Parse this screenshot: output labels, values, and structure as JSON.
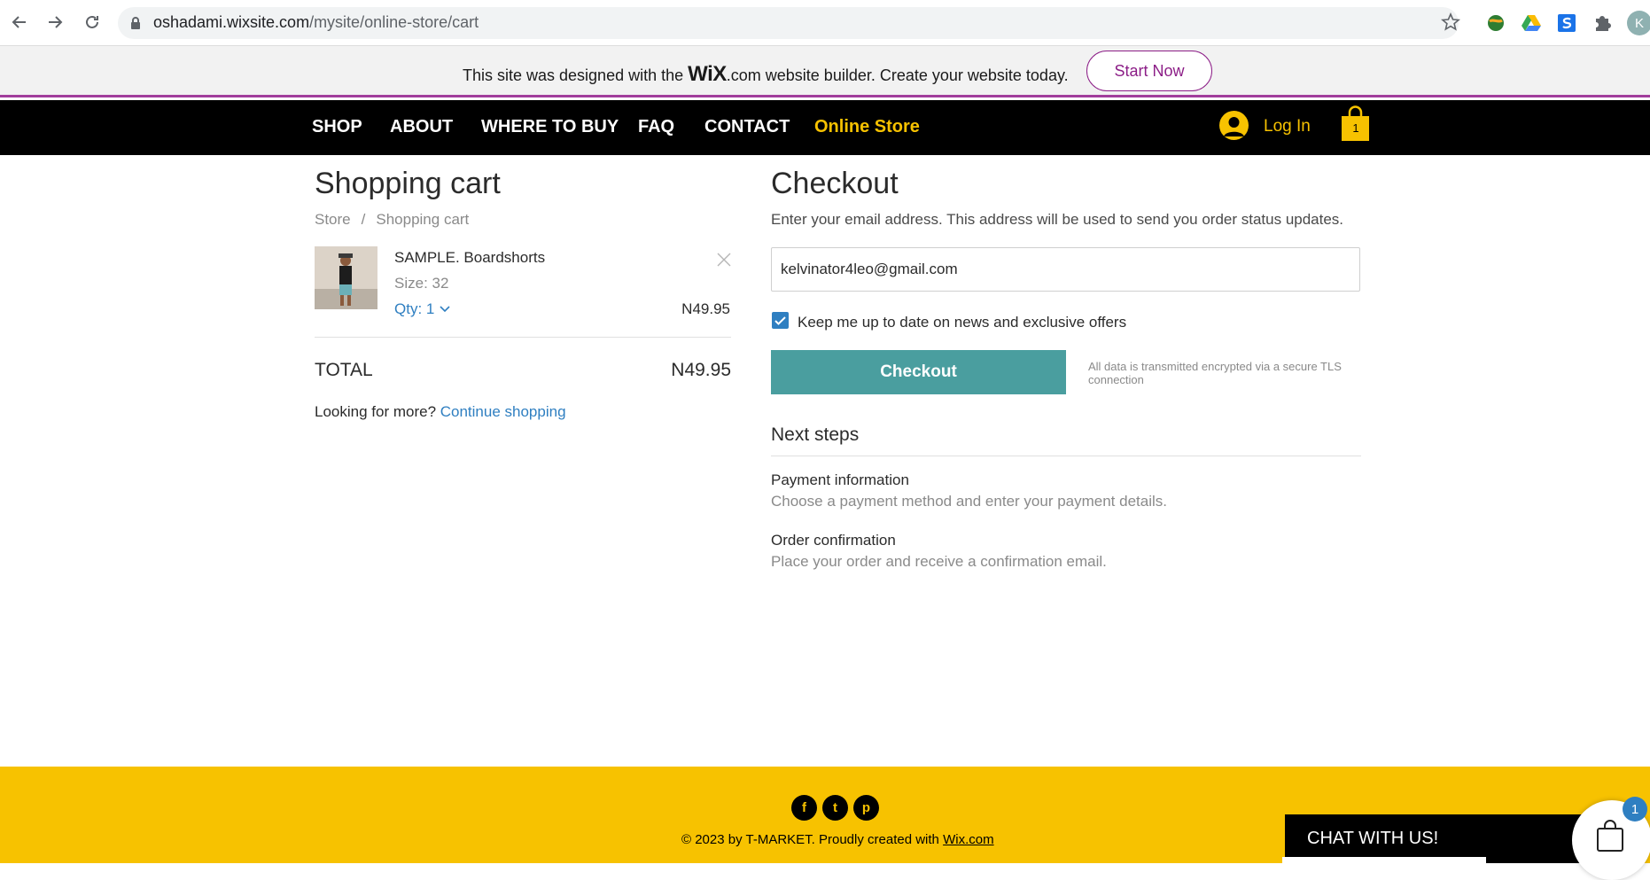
{
  "browser": {
    "url_domain": "oshadami.wixsite.com",
    "url_path": "/mysite/online-store/cart",
    "profile_initial": "K"
  },
  "wix_banner": {
    "text_before": "This site was designed with the ",
    "logo": "WiX",
    "text_after": ".com website builder. Create your website today.",
    "cta": "Start Now"
  },
  "nav": {
    "items": [
      "SHOP",
      "ABOUT",
      "WHERE TO BUY",
      "FAQ",
      "CONTACT",
      "Online Store"
    ],
    "login": "Log In",
    "cart_count": "1"
  },
  "cart": {
    "title": "Shopping cart",
    "breadcrumb": [
      "Store",
      "/",
      "Shopping cart"
    ],
    "item": {
      "name": "SAMPLE. Boardshorts",
      "size": "Size: 32",
      "qty": "Qty: 1",
      "price": "N49.95"
    },
    "total_label": "TOTAL",
    "total_value": "N49.95",
    "looking_more": "Looking for more? ",
    "continue": "Continue shopping"
  },
  "checkout": {
    "title": "Checkout",
    "description": "Enter your email address. This address will be used to send you order status updates.",
    "email": "kelvinator4leo@gmail.com",
    "newsletter_label": "Keep me up to date on news and exclusive offers",
    "button": "Checkout",
    "secure_note": "All data is transmitted encrypted via a secure TLS connection",
    "next_steps_title": "Next steps",
    "steps": [
      {
        "title": "Payment information",
        "desc": "Choose a payment method and enter your payment details."
      },
      {
        "title": "Order confirmation",
        "desc": "Place your order and receive a confirmation email."
      }
    ]
  },
  "footer": {
    "copyright": "© 2023 by T-MARKET. Proudly created with ",
    "link": "Wix.com",
    "social": [
      "f",
      "t",
      "p"
    ]
  },
  "chat": {
    "label": "CHAT WITH US!",
    "cart_badge": "1"
  },
  "colors": {
    "nav_bg": "#000000",
    "accent_yellow": "#f7c200",
    "checkout_button": "#4a9e9f",
    "link_blue": "#2f7fc1",
    "wix_purple": "#8c1e87"
  }
}
